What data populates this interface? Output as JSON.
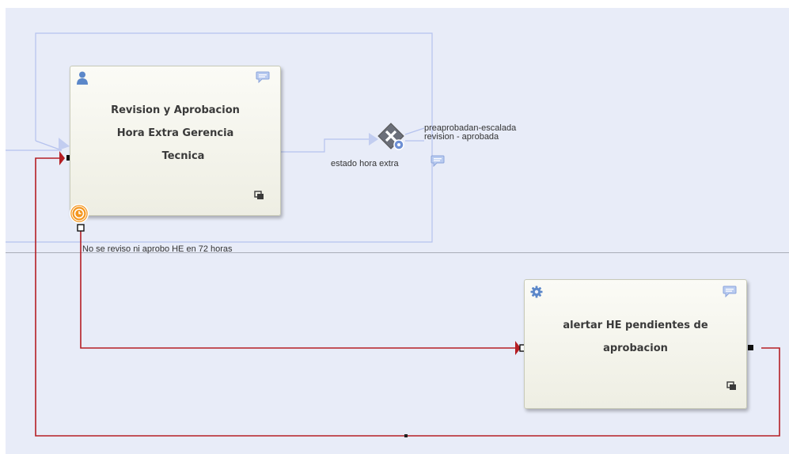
{
  "tasks": {
    "revision": {
      "title_lines": [
        "Revision y Aprobacion",
        "Hora Extra Gerencia",
        "Tecnica"
      ],
      "type_icon": "user-icon",
      "comment_icon": "comment-icon",
      "subprocess_icon": "collapse-icon",
      "boundary_event_icon": "timer-event-icon"
    },
    "alertar": {
      "title_lines": [
        "alertar HE pendientes de",
        "aprobacion"
      ],
      "type_icon": "service-gear-icon",
      "comment_icon": "comment-icon",
      "subprocess_icon": "collapse-icon"
    }
  },
  "gateway": {
    "label": "estado hora extra",
    "icon": "exclusive-gateway-icon",
    "outgoing_labels": [
      "preaprobadan-escalada",
      "revision - aprobada"
    ]
  },
  "timer_flow_label": "No se reviso ni aprobo HE en 72 horas",
  "colors": {
    "canvas": "#e8ecf8",
    "lane_line": "#b5c2ee",
    "flow_red": "#b51e24",
    "task_border": "#c8cab8",
    "timer_orange": "#f4961e",
    "icon_blue": "#5b87c9"
  }
}
